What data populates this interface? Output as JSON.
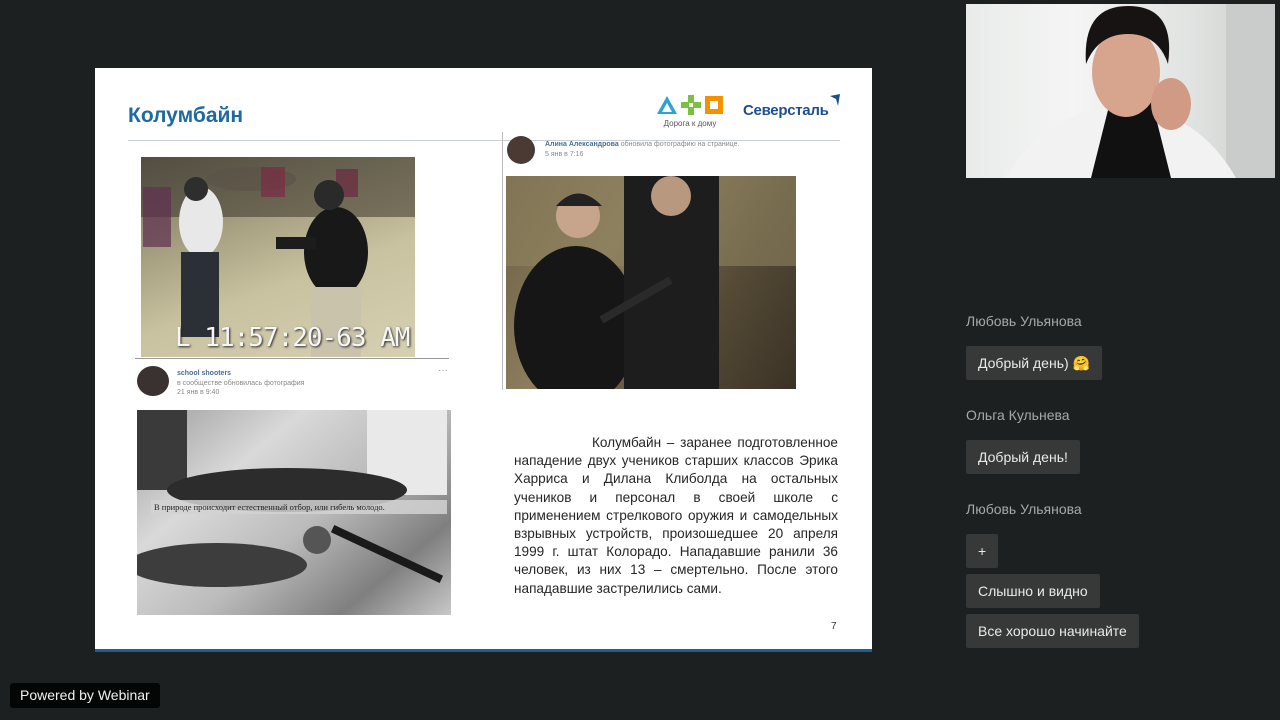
{
  "slide": {
    "title": "Колумбайн",
    "logo_caption": "Дорога к дому",
    "brand": "Северсталь",
    "cctv_timestamp": "L 11:57:20-63 AM",
    "post_top": {
      "author": "Алина Александрова",
      "action": "обновила фотографию на странице.",
      "date": "5 янв в 7:16"
    },
    "post_bottom": {
      "author": "school shooters",
      "action": "в сообществе обновилась фотография",
      "date": "21 янв в 9:40"
    },
    "photo_caption": "В природе происходит естественный отбор, или гибель молодо.",
    "body": "Колумбайн – заранее подготовленное нападение двух учеников старших классов Эрика Харриса и Дилана Клиболда на остальных учеников и персонал в своей школе с применением стрелкового оружия и самодельных взрывных устройств, произошедшее 20 апреля 1999 г. штат Колорадо. Нападавшие ранили 36 человек, из них 13 – смертельно. После этого нападавшие застрелились сами.",
    "page_number": "7"
  },
  "chat": {
    "messages": [
      {
        "author": "Любовь Ульянова",
        "text": "Добрый день) 🤗"
      },
      {
        "author": "Ольга Кульнева",
        "text": "Добрый день!"
      },
      {
        "author": "Любовь Ульянова",
        "texts": [
          "+",
          "Слышно и видно",
          "Все хорошо начинайте"
        ]
      }
    ]
  },
  "footer": {
    "powered_by": "Powered by Webinar"
  },
  "colors": {
    "background": "#1d2020",
    "bubble": "#363938",
    "title": "#1e6aa0",
    "brand": "#1c4f8f"
  }
}
